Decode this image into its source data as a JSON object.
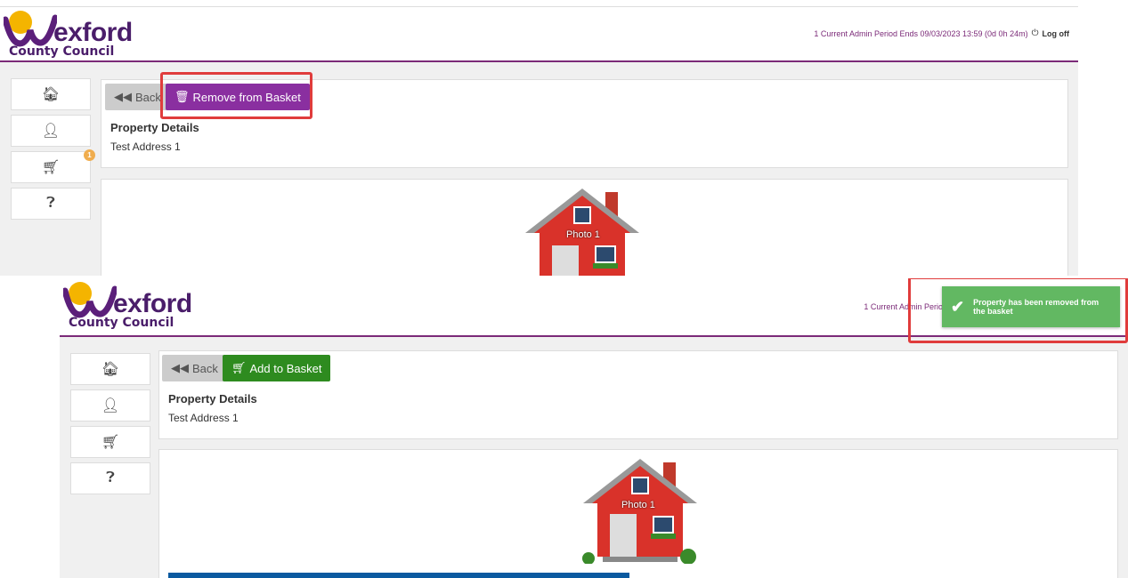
{
  "brand": {
    "name_main": "exford",
    "name_sub": "County Council",
    "purple": "#7b2a78",
    "accent": "#f4b400"
  },
  "header": {
    "admin_period": "1 Current Admin Period Ends 09/03/2023 13:59 (0d 0h 24m)",
    "admin_period_bottom": "1 Current Admin Period Ends 09/03/2023 13:59 (0d 0h 23m)",
    "logoff_label": "Log off",
    "power_icon": "power-icon"
  },
  "sidebar": {
    "items": [
      {
        "name": "home",
        "icon": "home-icon"
      },
      {
        "name": "user",
        "icon": "user-icon"
      },
      {
        "name": "basket",
        "icon": "cart-icon"
      },
      {
        "name": "help",
        "icon": "question-icon"
      }
    ],
    "basket_badge_top": "1"
  },
  "top": {
    "back_label": "Back",
    "remove_label": "Remove from Basket",
    "property_title": "Property Details",
    "property_address": "Test Address 1",
    "photo_label": "Photo 1"
  },
  "bottom": {
    "back_label": "Back",
    "add_label": "Add to Basket",
    "property_title": "Property Details",
    "property_address": "Test Address 1",
    "photo_label": "Photo 1",
    "toast_message": "Property has been removed from the basket"
  }
}
